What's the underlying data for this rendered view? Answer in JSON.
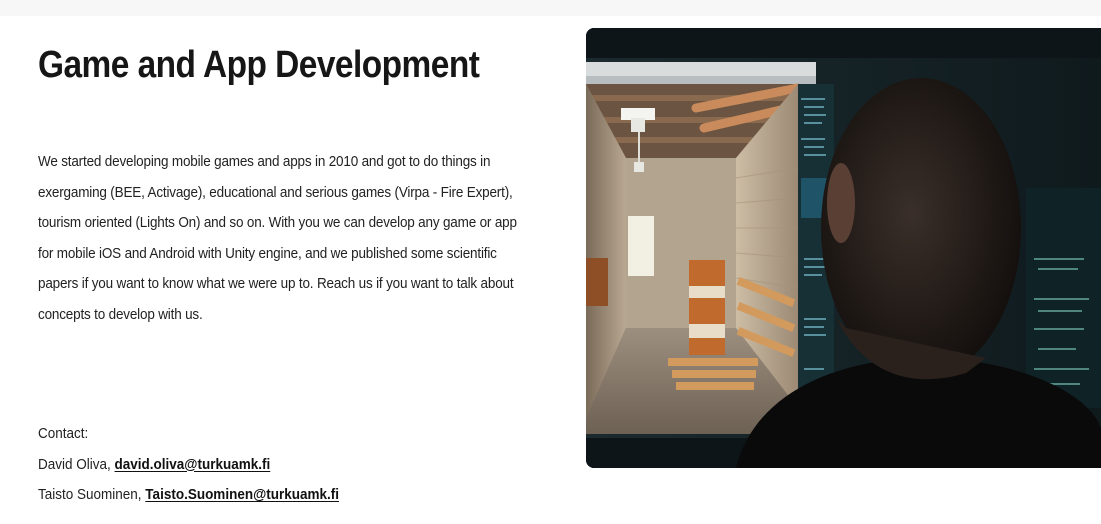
{
  "page": {
    "title": "Game and App Development",
    "paragraph_lines": [
      "We started developing mobile games and apps in 2010 and got to do things in",
      "exergaming (BEE, Activage), educational and serious games (Virpa - Fire Expert),",
      "tourism oriented (Lights On) and so on. With you we can develop any game or app",
      "for mobile iOS and Android with Unity engine, and we published some scientific",
      "papers if you want to know what we were up to. Reach us if you want to talk about",
      "concepts to develop with us."
    ],
    "contact": {
      "label": "Contact:",
      "people": [
        {
          "name": "David Oliva, ",
          "email": "david.oliva@turkuamk.fi"
        },
        {
          "name": "Taisto Suominen, ",
          "email": "Taisto.Suominen@turkuamk.fi"
        }
      ]
    }
  },
  "image": {
    "subject": "person-viewing-game-engine-monitor"
  }
}
